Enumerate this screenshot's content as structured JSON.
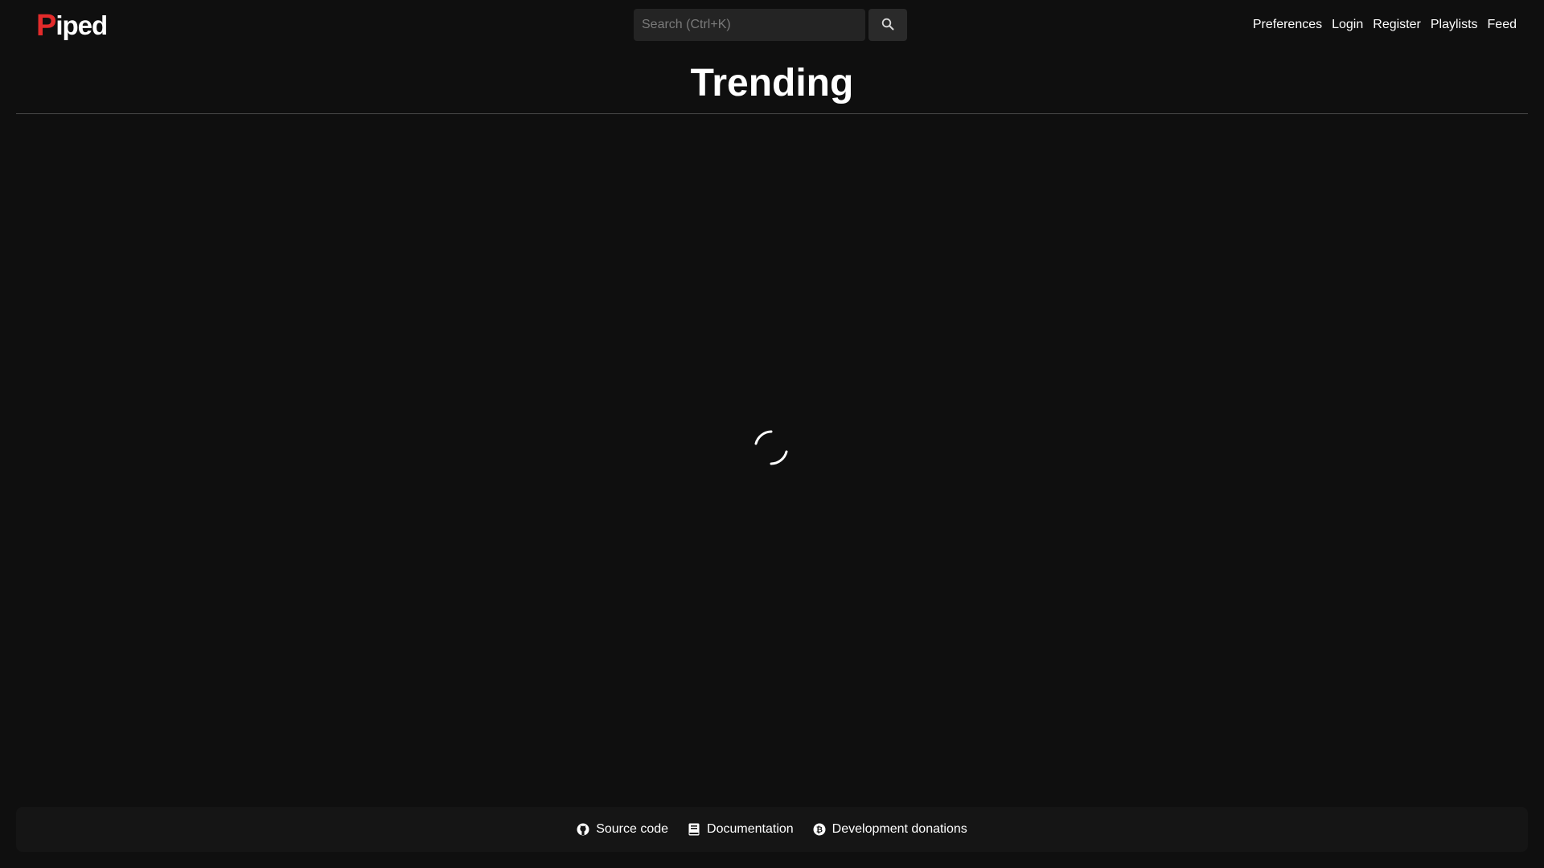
{
  "header": {
    "logo": {
      "initial": "P",
      "rest": "iped",
      "accent_color": "#e32b2b"
    },
    "search": {
      "placeholder": "Search (Ctrl+K)",
      "value": "",
      "button_icon": "search-icon"
    },
    "nav": [
      {
        "label": "Preferences"
      },
      {
        "label": "Login"
      },
      {
        "label": "Register"
      },
      {
        "label": "Playlists"
      },
      {
        "label": "Feed"
      }
    ]
  },
  "main": {
    "title": "Trending",
    "loading_indicator": "loading-spinner-icon"
  },
  "footer": {
    "links": [
      {
        "label": "Source code",
        "icon": "github-icon"
      },
      {
        "label": "Documentation",
        "icon": "book-icon"
      },
      {
        "label": "Development donations",
        "icon": "donate-icon"
      }
    ]
  },
  "colors": {
    "background": "#0f0f0f",
    "text": "#ffffff",
    "accent": "#e32b2b"
  }
}
